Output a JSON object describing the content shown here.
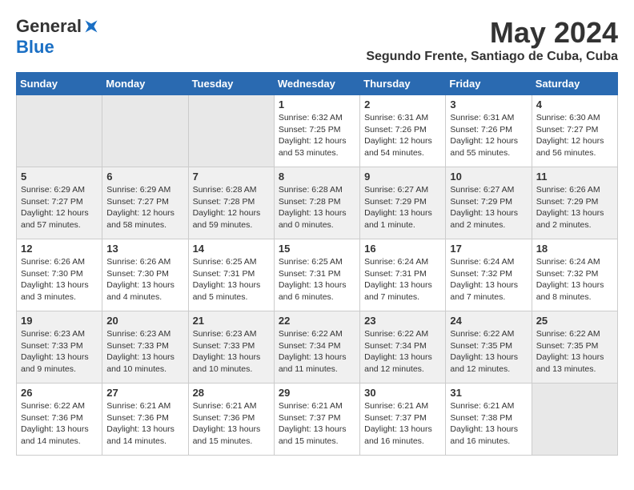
{
  "logo": {
    "general": "General",
    "blue": "Blue"
  },
  "title": {
    "month_year": "May 2024",
    "location": "Segundo Frente, Santiago de Cuba, Cuba"
  },
  "headers": [
    "Sunday",
    "Monday",
    "Tuesday",
    "Wednesday",
    "Thursday",
    "Friday",
    "Saturday"
  ],
  "weeks": [
    [
      {
        "day": "",
        "info": ""
      },
      {
        "day": "",
        "info": ""
      },
      {
        "day": "",
        "info": ""
      },
      {
        "day": "1",
        "info": "Sunrise: 6:32 AM\nSunset: 7:25 PM\nDaylight: 12 hours\nand 53 minutes."
      },
      {
        "day": "2",
        "info": "Sunrise: 6:31 AM\nSunset: 7:26 PM\nDaylight: 12 hours\nand 54 minutes."
      },
      {
        "day": "3",
        "info": "Sunrise: 6:31 AM\nSunset: 7:26 PM\nDaylight: 12 hours\nand 55 minutes."
      },
      {
        "day": "4",
        "info": "Sunrise: 6:30 AM\nSunset: 7:27 PM\nDaylight: 12 hours\nand 56 minutes."
      }
    ],
    [
      {
        "day": "5",
        "info": "Sunrise: 6:29 AM\nSunset: 7:27 PM\nDaylight: 12 hours\nand 57 minutes."
      },
      {
        "day": "6",
        "info": "Sunrise: 6:29 AM\nSunset: 7:27 PM\nDaylight: 12 hours\nand 58 minutes."
      },
      {
        "day": "7",
        "info": "Sunrise: 6:28 AM\nSunset: 7:28 PM\nDaylight: 12 hours\nand 59 minutes."
      },
      {
        "day": "8",
        "info": "Sunrise: 6:28 AM\nSunset: 7:28 PM\nDaylight: 13 hours\nand 0 minutes."
      },
      {
        "day": "9",
        "info": "Sunrise: 6:27 AM\nSunset: 7:29 PM\nDaylight: 13 hours\nand 1 minute."
      },
      {
        "day": "10",
        "info": "Sunrise: 6:27 AM\nSunset: 7:29 PM\nDaylight: 13 hours\nand 2 minutes."
      },
      {
        "day": "11",
        "info": "Sunrise: 6:26 AM\nSunset: 7:29 PM\nDaylight: 13 hours\nand 2 minutes."
      }
    ],
    [
      {
        "day": "12",
        "info": "Sunrise: 6:26 AM\nSunset: 7:30 PM\nDaylight: 13 hours\nand 3 minutes."
      },
      {
        "day": "13",
        "info": "Sunrise: 6:26 AM\nSunset: 7:30 PM\nDaylight: 13 hours\nand 4 minutes."
      },
      {
        "day": "14",
        "info": "Sunrise: 6:25 AM\nSunset: 7:31 PM\nDaylight: 13 hours\nand 5 minutes."
      },
      {
        "day": "15",
        "info": "Sunrise: 6:25 AM\nSunset: 7:31 PM\nDaylight: 13 hours\nand 6 minutes."
      },
      {
        "day": "16",
        "info": "Sunrise: 6:24 AM\nSunset: 7:31 PM\nDaylight: 13 hours\nand 7 minutes."
      },
      {
        "day": "17",
        "info": "Sunrise: 6:24 AM\nSunset: 7:32 PM\nDaylight: 13 hours\nand 7 minutes."
      },
      {
        "day": "18",
        "info": "Sunrise: 6:24 AM\nSunset: 7:32 PM\nDaylight: 13 hours\nand 8 minutes."
      }
    ],
    [
      {
        "day": "19",
        "info": "Sunrise: 6:23 AM\nSunset: 7:33 PM\nDaylight: 13 hours\nand 9 minutes."
      },
      {
        "day": "20",
        "info": "Sunrise: 6:23 AM\nSunset: 7:33 PM\nDaylight: 13 hours\nand 10 minutes."
      },
      {
        "day": "21",
        "info": "Sunrise: 6:23 AM\nSunset: 7:33 PM\nDaylight: 13 hours\nand 10 minutes."
      },
      {
        "day": "22",
        "info": "Sunrise: 6:22 AM\nSunset: 7:34 PM\nDaylight: 13 hours\nand 11 minutes."
      },
      {
        "day": "23",
        "info": "Sunrise: 6:22 AM\nSunset: 7:34 PM\nDaylight: 13 hours\nand 12 minutes."
      },
      {
        "day": "24",
        "info": "Sunrise: 6:22 AM\nSunset: 7:35 PM\nDaylight: 13 hours\nand 12 minutes."
      },
      {
        "day": "25",
        "info": "Sunrise: 6:22 AM\nSunset: 7:35 PM\nDaylight: 13 hours\nand 13 minutes."
      }
    ],
    [
      {
        "day": "26",
        "info": "Sunrise: 6:22 AM\nSunset: 7:36 PM\nDaylight: 13 hours\nand 14 minutes."
      },
      {
        "day": "27",
        "info": "Sunrise: 6:21 AM\nSunset: 7:36 PM\nDaylight: 13 hours\nand 14 minutes."
      },
      {
        "day": "28",
        "info": "Sunrise: 6:21 AM\nSunset: 7:36 PM\nDaylight: 13 hours\nand 15 minutes."
      },
      {
        "day": "29",
        "info": "Sunrise: 6:21 AM\nSunset: 7:37 PM\nDaylight: 13 hours\nand 15 minutes."
      },
      {
        "day": "30",
        "info": "Sunrise: 6:21 AM\nSunset: 7:37 PM\nDaylight: 13 hours\nand 16 minutes."
      },
      {
        "day": "31",
        "info": "Sunrise: 6:21 AM\nSunset: 7:38 PM\nDaylight: 13 hours\nand 16 minutes."
      },
      {
        "day": "",
        "info": ""
      }
    ]
  ]
}
